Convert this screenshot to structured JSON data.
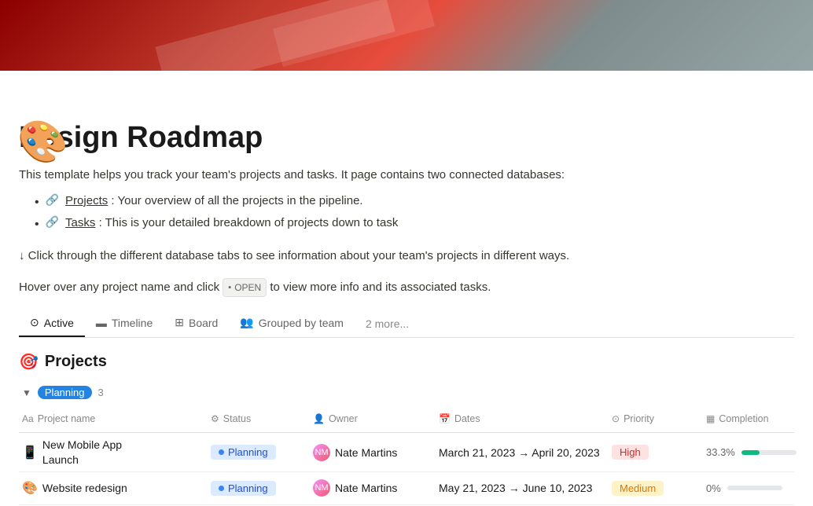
{
  "banner": {
    "alt": "Design Roadmap banner"
  },
  "icon": "🎨",
  "title": "Design Roadmap",
  "description": "This template helps you track your team's projects and tasks. It page contains two connected databases:",
  "bullets": [
    {
      "icon": "🔗",
      "link": "Projects",
      "text": ": Your overview of all the projects in the pipeline."
    },
    {
      "icon": "🔗",
      "link": "Tasks",
      "text": ": This is your detailed breakdown of projects down to task"
    }
  ],
  "instruction_line1": "↓ Click through the different database tabs to see information about your team's projects in different ways.",
  "instruction_line2_pre": "Hover over any project name and click",
  "open_badge": "OPEN",
  "instruction_line2_post": "to view more info and its associated tasks.",
  "tabs": [
    {
      "id": "active",
      "label": "Active",
      "icon": "⊙",
      "active": true
    },
    {
      "id": "timeline",
      "label": "Timeline",
      "icon": "▬"
    },
    {
      "id": "board",
      "label": "Board",
      "icon": "⊞"
    },
    {
      "id": "grouped",
      "label": "Grouped by team",
      "icon": "👥"
    }
  ],
  "more_tabs": "2 more...",
  "section": {
    "icon": "🎯",
    "title": "Projects"
  },
  "group": {
    "chevron": "▼",
    "label": "Planning",
    "count": "3"
  },
  "table": {
    "columns": [
      {
        "id": "project",
        "label": "Project name",
        "icon": "Aa"
      },
      {
        "id": "status",
        "label": "Status",
        "icon": "⚙"
      },
      {
        "id": "owner",
        "label": "Owner",
        "icon": "👤"
      },
      {
        "id": "dates",
        "label": "Dates",
        "icon": "📅"
      },
      {
        "id": "priority",
        "label": "Priority",
        "icon": "⊙"
      },
      {
        "id": "completion",
        "label": "Completion",
        "icon": "▦"
      }
    ],
    "rows": [
      {
        "emoji": "📱",
        "name": "New Mobile App\nLaunch",
        "status": "Planning",
        "owner": "Nate Martins",
        "owner_initials": "NM",
        "dates": "March 21, 2023 → April 20, 2023",
        "priority": "High",
        "priority_type": "high",
        "completion": "33.3%",
        "completion_pct": 33.3
      },
      {
        "emoji": "🎨",
        "name": "Website redesign",
        "status": "Planning",
        "owner": "Nate Martins",
        "owner_initials": "NM",
        "dates": "May 21, 2023 → June 10, 2023",
        "priority": "Medium",
        "priority_type": "medium",
        "completion": "0%",
        "completion_pct": 0
      }
    ]
  }
}
